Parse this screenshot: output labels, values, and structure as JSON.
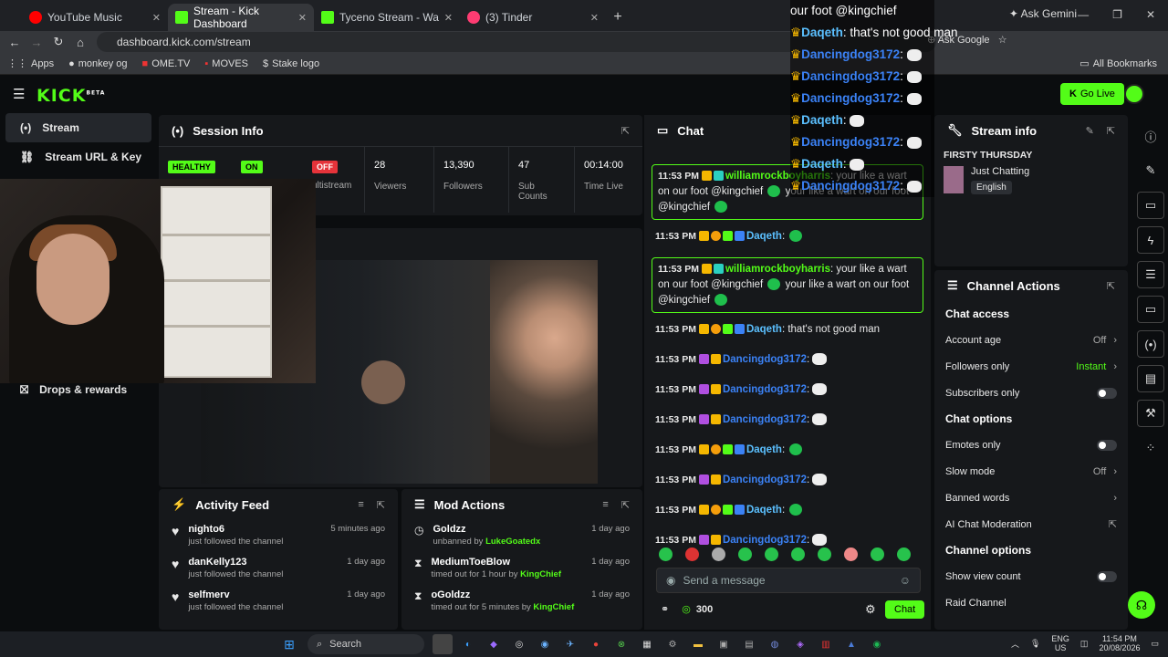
{
  "browser": {
    "tabs": [
      {
        "label": "YouTube Music"
      },
      {
        "label": "Stream - Kick Dashboard"
      },
      {
        "label": "Tyceno Stream - Watch Live on"
      },
      {
        "label": "(3) Tinder"
      }
    ],
    "gemini_label": "Ask Gemini",
    "url": "dashboard.kick.com/stream",
    "ask_google": "Ask Google",
    "bookmarks": [
      "Apps",
      "monkey og",
      "OME.TV",
      "MOVES",
      "Stake logo"
    ],
    "all_bookmarks": "All Bookmarks"
  },
  "kick": {
    "logo": "KICK",
    "logo_beta": "BETA",
    "go_live": "Go Live"
  },
  "sidebar": {
    "items": [
      {
        "label": "Stream"
      },
      {
        "label": "Stream URL & Key"
      },
      {
        "label": "Drops & rewards"
      }
    ]
  },
  "session": {
    "title": "Session Info",
    "health": "HEALTHY",
    "on": "ON",
    "off": "OFF",
    "multistream": "ultistream",
    "stats": [
      {
        "value": "28",
        "label": "Viewers"
      },
      {
        "value": "13,390",
        "label": "Followers"
      },
      {
        "value": "47",
        "label": "Sub Counts"
      },
      {
        "value": "00:14:00",
        "label": "Time Live"
      }
    ]
  },
  "activity": {
    "title": "Activity Feed",
    "items": [
      {
        "name": "nighto6",
        "desc": "just followed the channel",
        "time": "5 minutes ago"
      },
      {
        "name": "danKelly123",
        "desc": "just followed the channel",
        "time": "1 day ago"
      },
      {
        "name": "selfmerv",
        "desc": "just followed the channel",
        "time": "1 day ago"
      }
    ]
  },
  "mod": {
    "title": "Mod Actions",
    "items": [
      {
        "name": "Goldzz",
        "action": "unbanned by",
        "by": "LukeGoatedx",
        "time": "1 day ago"
      },
      {
        "name": "MediumToeBlow",
        "action": "timed out for 1 hour by",
        "by": "KingChief",
        "time": "1 day ago"
      },
      {
        "name": "oGoldzz",
        "action": "timed out for 5 minutes by",
        "by": "KingChief",
        "time": "1 day ago"
      }
    ]
  },
  "chat": {
    "title": "Chat",
    "messages": [
      {
        "time": "11:53 PM",
        "user": "williamrockboyharris",
        "text": "your like a wart on our foot @kingchief",
        "text2": "your like a wart on our foot @kingchief",
        "highlight": true
      },
      {
        "time": "11:53 PM",
        "user": "Daqeth",
        "text": ""
      },
      {
        "time": "11:53 PM",
        "user": "williamrockboyharris",
        "text": "your like a wart on our foot @kingchief",
        "text2": "your like a wart on our foot @kingchief",
        "highlight": true
      },
      {
        "time": "11:53 PM",
        "user": "Daqeth",
        "text": "that's not good man"
      },
      {
        "time": "11:53 PM",
        "user": "Dancingdog3172",
        "text": ""
      },
      {
        "time": "11:53 PM",
        "user": "Dancingdog3172",
        "text": ""
      },
      {
        "time": "11:53 PM",
        "user": "Dancingdog3172",
        "text": ""
      },
      {
        "time": "11:53 PM",
        "user": "Daqeth",
        "text": ""
      },
      {
        "time": "11:53 PM",
        "user": "Dancingdog3172",
        "text": ""
      },
      {
        "time": "11:53 PM",
        "user": "Daqeth",
        "text": ""
      },
      {
        "time": "11:53 PM",
        "user": "Dancingdog3172",
        "text": ""
      }
    ],
    "placeholder": "Send a message",
    "points": "300",
    "send_label": "Chat"
  },
  "stream_info": {
    "title": "Stream info",
    "stream_title": "FIRSTY THURSDAY",
    "category": "Just Chatting",
    "language": "English"
  },
  "channel_actions": {
    "title": "Channel Actions",
    "chat_access": "Chat access",
    "account_age": {
      "label": "Account age",
      "value": "Off"
    },
    "followers_only": {
      "label": "Followers only",
      "value": "Instant"
    },
    "subscribers_only": {
      "label": "Subscribers only"
    },
    "chat_options": "Chat options",
    "emotes_only": {
      "label": "Emotes only"
    },
    "slow_mode": {
      "label": "Slow mode",
      "value": "Off"
    },
    "banned_words": {
      "label": "Banned words"
    },
    "ai_moderation": {
      "label": "AI Chat Moderation"
    },
    "channel_options": "Channel options",
    "show_view_count": {
      "label": "Show view count"
    },
    "raid_channel": {
      "label": "Raid Channel"
    }
  },
  "overlay": {
    "lines": [
      {
        "user": "",
        "text": "our foot @kingchief"
      },
      {
        "user": "Daqeth",
        "text": "that's not good man"
      },
      {
        "user": "Dancingdog3172",
        "text": ""
      },
      {
        "user": "Dancingdog3172",
        "text": ""
      },
      {
        "user": "Dancingdog3172",
        "text": ""
      },
      {
        "user": "Daqeth",
        "text": ""
      },
      {
        "user": "Dancingdog3172",
        "text": ""
      },
      {
        "user": "Daqeth",
        "text": ""
      },
      {
        "user": "Dancingdog3172",
        "text": ""
      }
    ]
  },
  "taskbar": {
    "search": "Search",
    "lang": "ENG",
    "region": "US",
    "time": "11:54 PM",
    "date": "20/08/2026"
  },
  "colors": {
    "accent": "#53fc18",
    "bg": "#0b0d0f",
    "panel": "#16181b"
  }
}
